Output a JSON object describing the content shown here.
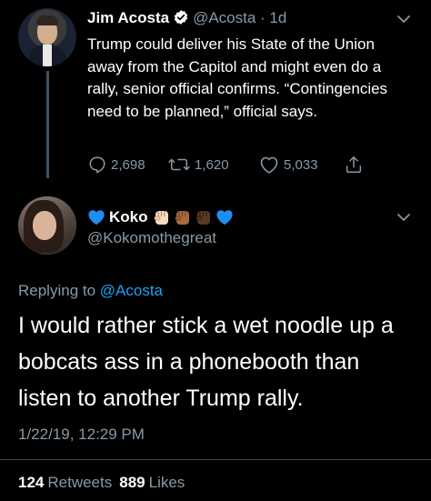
{
  "parent_tweet": {
    "display_name": "Jim Acosta",
    "handle": "@Acosta",
    "separator": " · ",
    "age": "1d",
    "text": "Trump could deliver his State of the Union away from the Capitol and might even do a rally, senior official confirms. “Contingencies need to be planned,” official says.",
    "replies": "2,698",
    "retweets": "1,620",
    "likes": "5,033",
    "icons": [
      "verified-icon",
      "chevron-down-icon",
      "reply-icon",
      "retweet-icon",
      "like-icon",
      "share-icon"
    ]
  },
  "reply_tweet": {
    "display_name": "Koko",
    "handle": "@Kokomothegreat",
    "replying_prefix": "Replying to ",
    "replying_mention": "@Acosta",
    "text": "I would rather stick a wet noodle up a bobcats ass in a phonebooth than listen to another Trump rally.",
    "timestamp": "1/22/19, 12:29 PM",
    "retweet_count": "124",
    "retweet_label": "Retweets",
    "like_count": "889",
    "like_label": "Likes",
    "icons": [
      "blue-heart-icon",
      "raised-fist-light-icon",
      "raised-fist-medium-icon",
      "raised-fist-dark-icon",
      "blue-heart-icon",
      "chevron-down-icon"
    ]
  },
  "colors": {
    "background": "#000000",
    "text": "#ffffff",
    "muted": "#8899a6",
    "link": "#1da1f2",
    "divider": "#38444d"
  }
}
